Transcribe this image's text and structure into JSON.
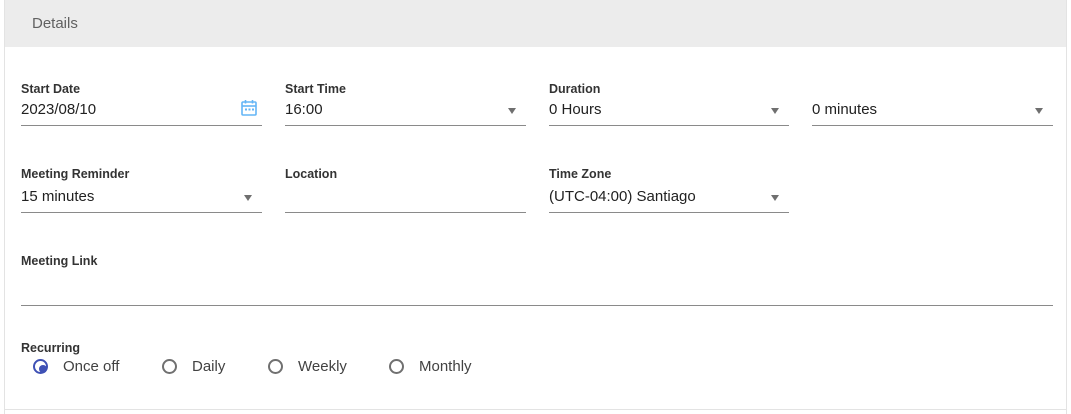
{
  "details": {
    "title": "Details"
  },
  "start_date": {
    "label": "Start Date",
    "value": "2023/08/10"
  },
  "start_time": {
    "label": "Start Time",
    "value": "16:00"
  },
  "duration": {
    "label": "Duration",
    "hours_value": "0 Hours",
    "minutes_value": "0 minutes"
  },
  "meeting_reminder": {
    "label": "Meeting Reminder",
    "value": "15 minutes"
  },
  "location": {
    "label": "Location",
    "value": ""
  },
  "time_zone": {
    "label": "Time Zone",
    "value": "(UTC-04:00) Santiago"
  },
  "meeting_link": {
    "label": "Meeting Link",
    "value": ""
  },
  "recurring": {
    "label": "Recurring",
    "selected": "Once off",
    "options": [
      "Once off",
      "Daily",
      "Weekly",
      "Monthly"
    ]
  },
  "colors": {
    "accent": "#3f51b5",
    "calendar_icon": "#64b5f6",
    "header_bg": "#ececec"
  },
  "icons": {
    "date_picker": "calendar-icon",
    "dropdown": "chevron-down-icon"
  }
}
